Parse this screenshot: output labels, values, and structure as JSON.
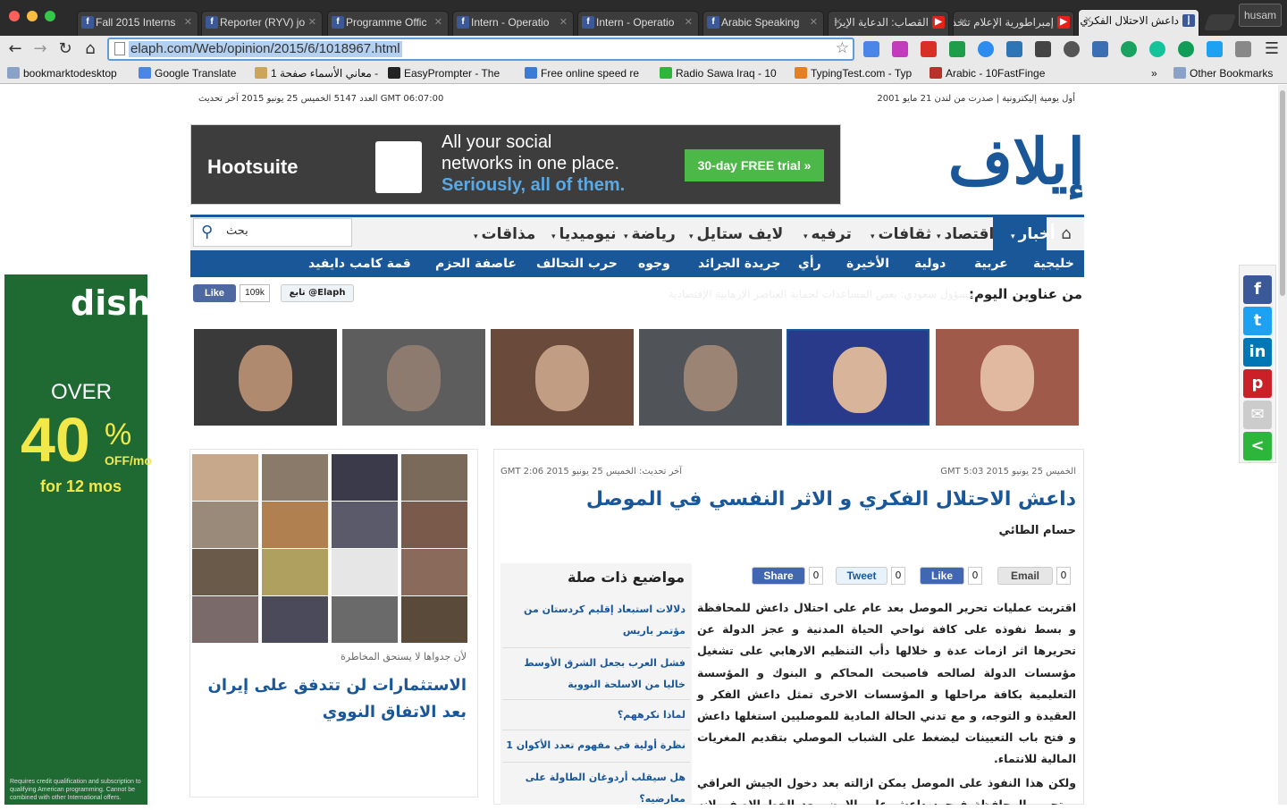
{
  "browser": {
    "tabs": [
      {
        "title": "Fall 2015 Interns",
        "icon": "f"
      },
      {
        "title": "Reporter (RYV) jo",
        "icon": "f"
      },
      {
        "title": "Programme Offic",
        "icon": "f"
      },
      {
        "title": "Intern - Operatio",
        "icon": "f"
      },
      {
        "title": "Intern - Operatio",
        "icon": "f"
      },
      {
        "title": "Arabic Speaking",
        "icon": "f"
      },
      {
        "title": "القصاب: الدعاية الإيرا",
        "icon": "yt"
      },
      {
        "title": "إمبراطورية الإعلام تتخذ",
        "icon": "yt"
      },
      {
        "title": "داعش الاحتلال الفكري",
        "icon": "e"
      }
    ],
    "profile": "husam",
    "url": "elaph.com/Web/opinion/2015/6/1018967.html",
    "bookmarks": [
      "bookmarktodesktop",
      "Google Translate",
      "معاني الأسماء صفحة 1 -",
      "EasyPrompter - The",
      "Free online speed re",
      "Radio Sawa Iraq - 10",
      "TypingTest.com - Typ",
      "Arabic - 10FastFinge",
      "Other Bookmarks"
    ],
    "overflow": "»"
  },
  "header": {
    "meta_right": "أول يومية إليكترونية | صدرت من لندن 21 مايو 2001",
    "meta_left": "العدد 5147 الخميس 25 يونيو 2015 آخر تحديث GMT 06:07:00",
    "logo": "إيلاف"
  },
  "ad_top": {
    "brand": "Hootsuite",
    "line1": "All your social",
    "line2": "networks in one place.",
    "line3": "Seriously, all of them.",
    "cta": "30-day FREE trial »"
  },
  "nav": {
    "main": [
      "أخبار",
      "اقتصاد",
      "ثقافات",
      "ترفيه",
      "لايف ستايل",
      "رياضة",
      "نيوميديا",
      "مذاقات"
    ],
    "sub": [
      "خليجية",
      "عربية",
      "دولية",
      "الأخيرة",
      "رأي",
      "جريدة الجرائد",
      "وجوه",
      "حرب التحالف",
      "عاصفة الحزم",
      "قمة كامب دايفيد"
    ],
    "search_placeholder": "بحث"
  },
  "social_bar": {
    "headlines_label": "من عناوين اليوم:",
    "ticker": "مسؤول سعودي: بعض المساعدات لحماية العناصر الإرهابية الإقتصادية",
    "like": "Like",
    "like_count": "109k",
    "follow": "تابع @Elaph"
  },
  "side_ad": {
    "brand": "dish",
    "over": "OVER",
    "percent": "40",
    "off": "OFF/mo",
    "duration": "for 12 mos",
    "fine": "Requires credit qualification and subscription to qualifying American programming. Cannot be combined with other International offers."
  },
  "article": {
    "date": "الخميس 25 يونيو 2015 GMT 5:03",
    "updated": "آخر تحديث: الخميس 25 يونيو 2015 GMT 2:06",
    "title": "داعش الاحتلال الفكري و الاثر النفسي في الموصل",
    "author": "حسام الطائي",
    "share": [
      {
        "label": "Share",
        "count": "0"
      },
      {
        "label": "Tweet",
        "count": "0"
      },
      {
        "label": "Like",
        "count": "0"
      },
      {
        "label": "Email",
        "count": "0"
      }
    ],
    "p1": "اقتربت عمليات تحرير الموصل بعد عام على احتلال داعش للمحافظة و بسط نفوذه على كافة نواحي الحياة المدنية و عجز الدولة عن تحريرها اثر ازمات عدة و خلالها دأب التنظيم الارهابي على تشغيل مؤسسات الدولة لصالحه فاصبحت المحاكم و البنوك و المؤسسة التعليمية بكافة مراحلها و المؤسسات الاخرى تمثل داعش الفكر و العقيدة و التوجه، و مع تدني الحالة المادية للموصليين استغلها داعش و فتح باب التعيينات ليضغط على الشباب الموصلي بتقديم المغريات المالية للانتماء.",
    "p2": "ولكن هذا النفوذ على الموصل يمكن ازالته بعد دخول الجيش العراقي و تحرير المحافظة فوجود داعش على الارض بعد الخط الاصفر لانه واضح ويمكن قتاله"
  },
  "related": {
    "title": "مواضيع ذات صلة",
    "items": [
      "دلالات استبعاد إقليم كردستان من مؤتمر باريس",
      "فشل العرب بجعل الشرق الأوسط خاليا من الاسلحة النووية",
      "لماذا نكرههم؟",
      "نظرة أولية في مفهوم تعدد الأكوان 1",
      "هل سيقلب أردوغان الطاولة على معارضيه؟"
    ]
  },
  "left_col": {
    "kicker": "لأن جدواها لا يستحق المخاطرة",
    "headline": "الاستثمارات لن تتدفق على إيران بعد الاتفاق النووي"
  },
  "colors": {
    "brand": "#1a5799",
    "green": "#4cb848"
  }
}
